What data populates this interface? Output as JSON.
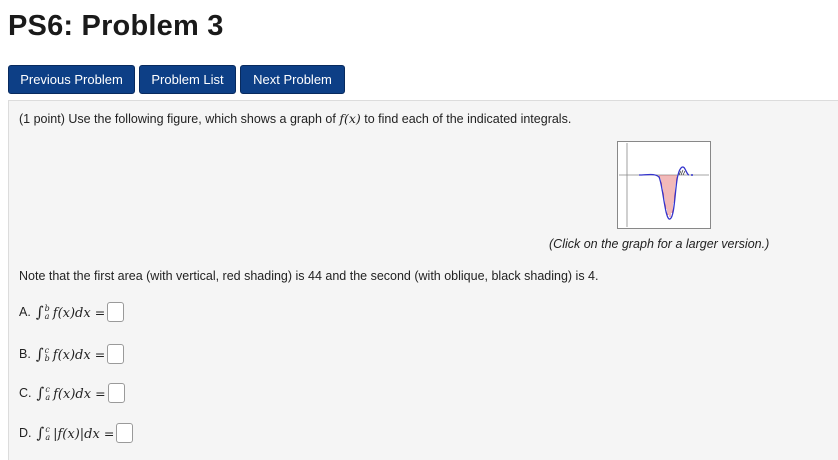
{
  "page": {
    "title": "PS6: Problem 3"
  },
  "nav": {
    "previous": "Previous Problem",
    "list": "Problem List",
    "next": "Next Problem"
  },
  "problem": {
    "points": "(1 point)",
    "intro_before": " Use the following figure, which shows a graph of ",
    "intro_func": "f(x)",
    "intro_after": " to find each of the indicated integrals.",
    "caption": "(Click on the graph for a larger version.)",
    "note": "Note that the first area (with vertical, red shading) is 44 and the second (with oblique, black shading) is 4.",
    "questions": [
      {
        "letter": "A.",
        "lower": "a",
        "upper": "b",
        "integrand": "f(x)dx",
        "equals": "="
      },
      {
        "letter": "B.",
        "lower": "b",
        "upper": "c",
        "integrand": "f(x)dx",
        "equals": "="
      },
      {
        "letter": "C.",
        "lower": "a",
        "upper": "c",
        "integrand": "f(x)dx",
        "equals": "="
      },
      {
        "letter": "D.",
        "lower": "a",
        "upper": "c",
        "integrand": "|f(x)|dx",
        "equals": "="
      }
    ]
  },
  "colors": {
    "button": "#0d3f86",
    "panel": "#f5f5f5",
    "curve": "#3333cc",
    "shade": "#e05050"
  }
}
